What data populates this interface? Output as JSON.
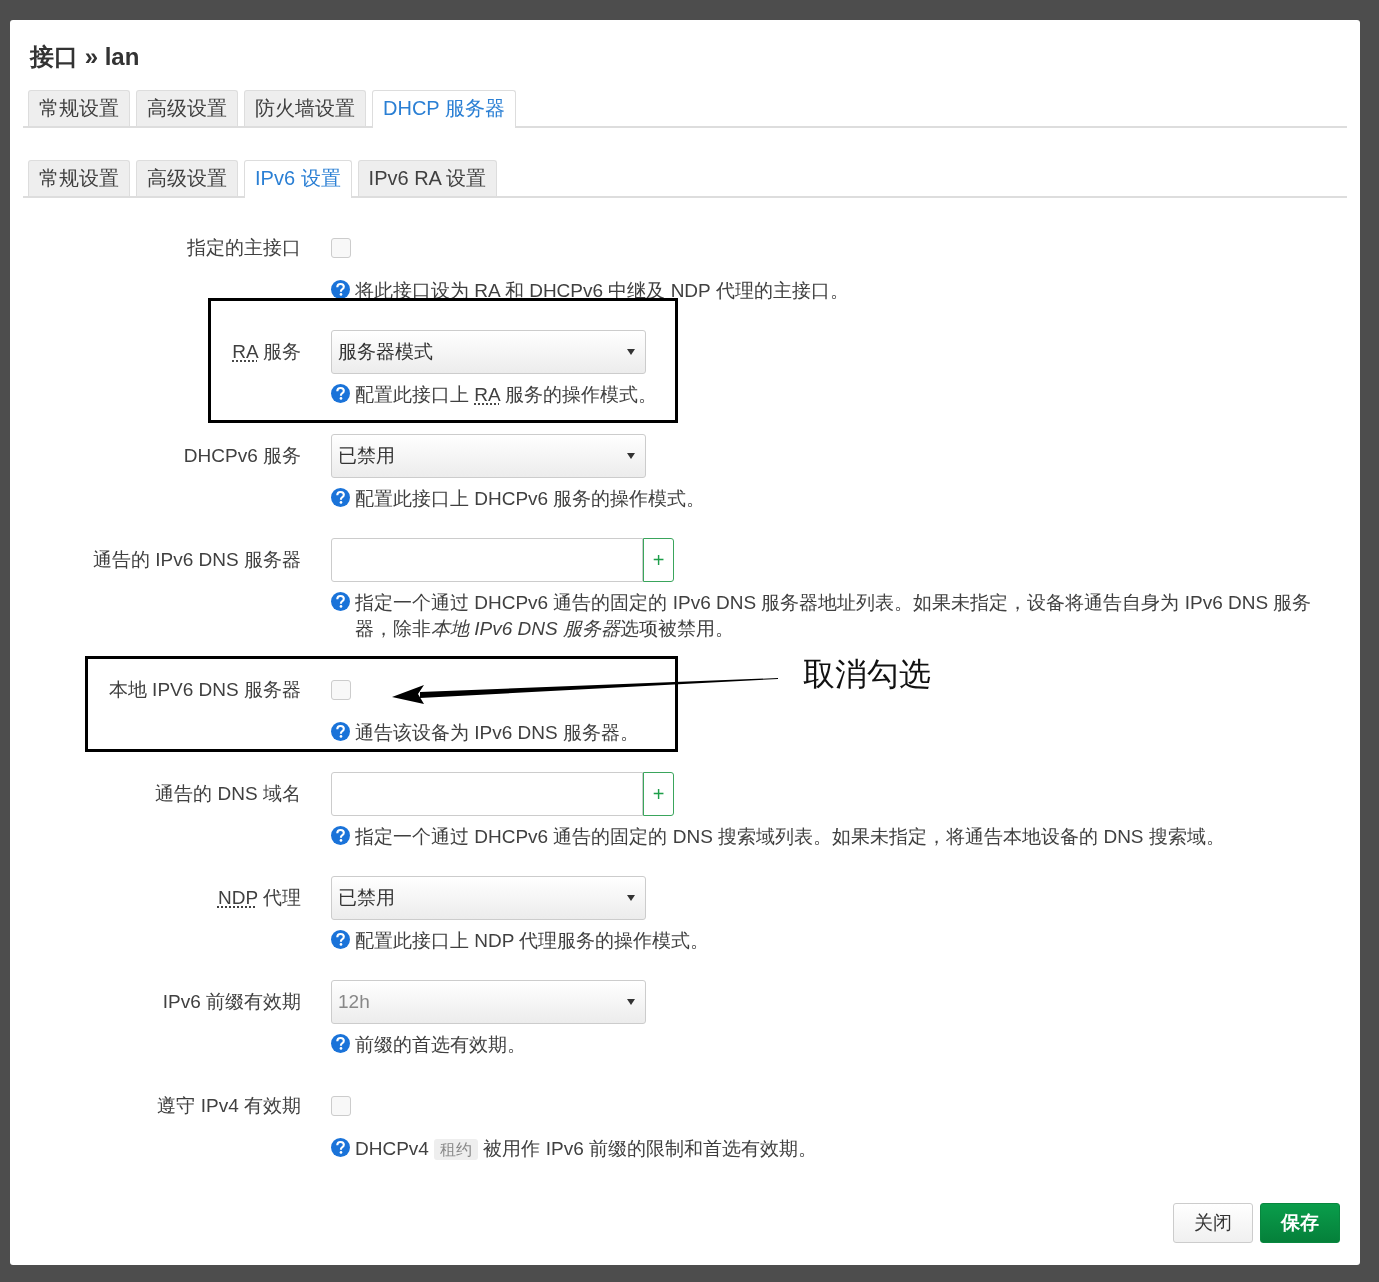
{
  "dialog": {
    "title": "接口 » lan",
    "tabs": [
      {
        "label": "常规设置",
        "selected": false
      },
      {
        "label": "高级设置",
        "selected": false
      },
      {
        "label": "防火墙设置",
        "selected": false
      },
      {
        "label": "DHCP 服务器",
        "selected": true
      }
    ],
    "subtabs": [
      {
        "label": "常规设置",
        "selected": false
      },
      {
        "label": "高级设置",
        "selected": false
      },
      {
        "label": "IPv6 设置",
        "selected": true
      },
      {
        "label": "IPv6 RA 设置",
        "selected": false
      }
    ],
    "fields": [
      {
        "kind": "checkbox",
        "label": [
          {
            "text": "指定的主接口"
          }
        ],
        "checked": false,
        "description": [
          {
            "text": "将此接口设为 RA 和 DHCPv6 中继及 NDP 代理的主接口。"
          }
        ]
      },
      {
        "kind": "select",
        "label": [
          {
            "text": "RA",
            "kind": "abbr"
          },
          {
            "text": " 服务"
          }
        ],
        "value": "服务器模式",
        "highlighted": true,
        "description": [
          {
            "text": "配置此接口上 "
          },
          {
            "text": "RA",
            "kind": "abbr"
          },
          {
            "text": " 服务的操作模式。"
          }
        ]
      },
      {
        "kind": "select",
        "label": [
          {
            "text": "DHCPv6 服务"
          }
        ],
        "value": "已禁用",
        "description": [
          {
            "text": "配置此接口上 DHCPv6 服务的操作模式。"
          }
        ]
      },
      {
        "kind": "dynlist",
        "label": [
          {
            "text": "通告的 IPv6 DNS 服务器"
          }
        ],
        "add_label": "+",
        "description": [
          {
            "text": "指定一个通过 DHCPv6 通告的固定的 IPv6 DNS 服务器地址列表。如果未指定，设备将通告自身为 IPv6 DNS 服务器，除非"
          },
          {
            "text": "本地 IPv6 DNS 服务器",
            "kind": "italic"
          },
          {
            "text": "选项被禁用。"
          }
        ]
      },
      {
        "kind": "checkbox",
        "label": [
          {
            "text": "本地 IPV6 DNS 服务器"
          }
        ],
        "checked": false,
        "highlighted": true,
        "note": "取消勾选",
        "description": [
          {
            "text": "通告该设备为 IPv6 DNS 服务器。"
          }
        ]
      },
      {
        "kind": "dynlist",
        "label": [
          {
            "text": "通告的 DNS 域名"
          }
        ],
        "add_label": "+",
        "description": [
          {
            "text": "指定一个通过 DHCPv6 通告的固定的 DNS 搜索域列表。如果未指定，将通告本地设备的 DNS 搜索域。"
          }
        ]
      },
      {
        "kind": "select",
        "label": [
          {
            "text": "NDP",
            "kind": "abbr"
          },
          {
            "text": " 代理"
          }
        ],
        "value": "已禁用",
        "description": [
          {
            "text": "配置此接口上 NDP 代理服务的操作模式。"
          }
        ]
      },
      {
        "kind": "select",
        "label": [
          {
            "text": "IPv6 前缀有效期"
          }
        ],
        "placeholder": "12h",
        "description": [
          {
            "text": "前缀的首选有效期。"
          }
        ]
      },
      {
        "kind": "checkbox",
        "label": [
          {
            "text": "遵守 IPv4 有效期"
          }
        ],
        "checked": false,
        "description": [
          {
            "text": "DHCPv4 "
          },
          {
            "text": "租约",
            "kind": "code"
          },
          {
            "text": " 被用作 IPv6 前缀的限制和首选有效期。"
          }
        ]
      }
    ],
    "buttons": [
      {
        "label": "关闭",
        "kind": "secondary"
      },
      {
        "label": "保存",
        "kind": "primary"
      }
    ]
  }
}
